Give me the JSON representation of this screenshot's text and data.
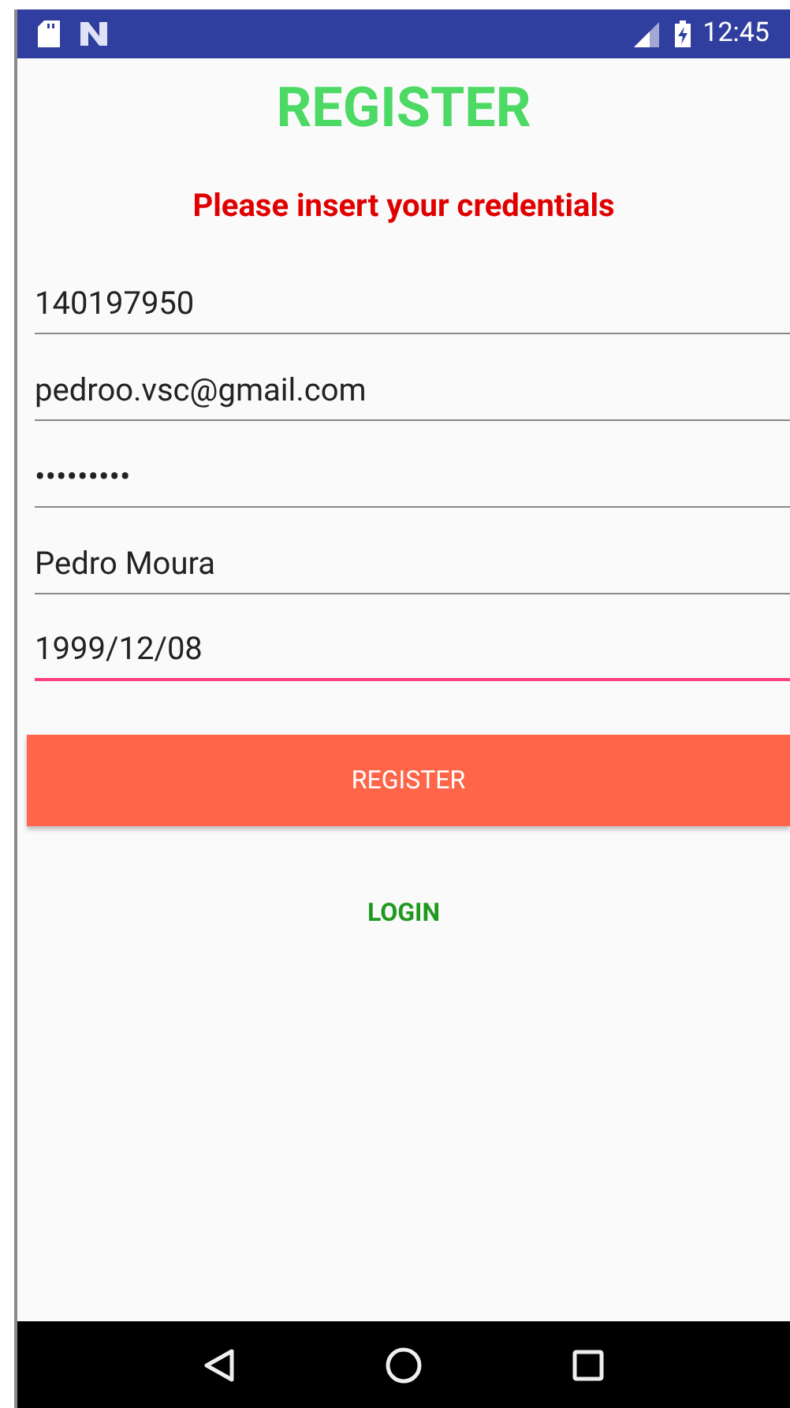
{
  "status_bar": {
    "time": "12:45"
  },
  "title": "REGISTER",
  "subtitle": "Please insert your credentials",
  "fields": [
    {
      "value": "140197950",
      "focused": false
    },
    {
      "value": "pedroo.vsc@gmail.com",
      "focused": false
    },
    {
      "value": "•••••••••",
      "focused": false
    },
    {
      "value": "Pedro Moura",
      "focused": false
    },
    {
      "value": "1999/12/08",
      "focused": true
    }
  ],
  "register_button": "REGISTER",
  "login_link": "LOGIN"
}
